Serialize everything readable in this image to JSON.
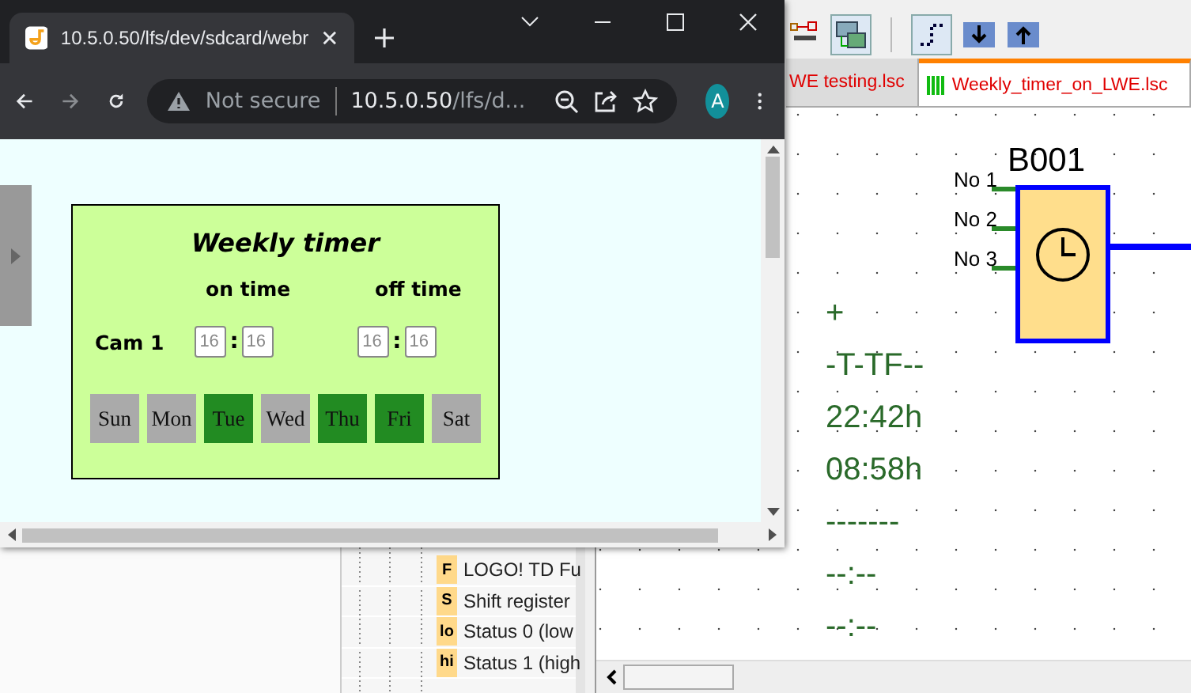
{
  "browser": {
    "tab_title": "10.5.0.50/lfs/dev/sdcard/webr",
    "security": "Not secure",
    "url_host": "10.5.0.50",
    "url_path": "/lfs/d...",
    "profile_initial": "A"
  },
  "page": {
    "title": "Weekly timer",
    "on_label": "on time",
    "off_label": "off time",
    "rows": [
      {
        "label": "Cam 1",
        "on_hour": "16",
        "on_minute": "16",
        "off_hour": "16",
        "off_minute": "16",
        "separator": ":"
      }
    ],
    "days": [
      {
        "label": "Sun",
        "selected": false
      },
      {
        "label": "Mon",
        "selected": false
      },
      {
        "label": "Tue",
        "selected": true
      },
      {
        "label": "Wed",
        "selected": false
      },
      {
        "label": "Thu",
        "selected": true
      },
      {
        "label": "Fri",
        "selected": true
      },
      {
        "label": "Sat",
        "selected": false
      }
    ]
  },
  "app": {
    "tabs": [
      {
        "label": "WE testing.lsc",
        "selected": false
      },
      {
        "label": "Weekly_timer_on_LWE.lsc",
        "selected": true
      }
    ],
    "tree_items": [
      {
        "badge": "F",
        "label": "LOGO! TD Fu"
      },
      {
        "badge": "S",
        "label": "Shift register"
      },
      {
        "badge": "lo",
        "label": "Status 0 (low"
      },
      {
        "badge": "hi",
        "label": "Status 1 (high"
      }
    ],
    "block": {
      "name": "B001",
      "inputs": [
        "No 1",
        "No 2",
        "No 3"
      ]
    },
    "parameters": [
      "+",
      "-T-TF--",
      "22:42h",
      "08:58h",
      "-------",
      "--:--",
      "--:--"
    ]
  }
}
